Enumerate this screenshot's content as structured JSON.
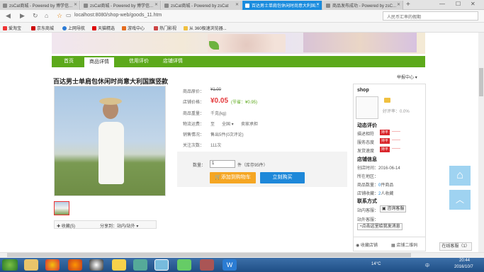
{
  "browser": {
    "tabs": [
      {
        "label": "zsCat商城 - Powered by 博学信...",
        "active": false
      },
      {
        "label": "zsCat商城 - Powered by 博学信...",
        "active": false
      },
      {
        "label": "zsCat商城 - Powered by zsCat",
        "active": false
      },
      {
        "label": "百达男士单肩包休闲时尚意大利国...",
        "active": true
      },
      {
        "label": "商品发布成功 - Powered by zsC...",
        "active": false
      }
    ],
    "new_tab": "+",
    "url": "localhost:8080/shop-web/goods_11.htm",
    "search_placeholder": "人民币汇率的假期",
    "bookmarks": [
      "爱淘宝",
      "京东商城",
      "上网导航",
      "天猫精选",
      "游戏中心",
      "热门影视",
      "从 360极速浏览器..."
    ]
  },
  "nav": {
    "items": [
      "首页",
      "商品详情",
      "信用评价",
      "店铺详情"
    ]
  },
  "product": {
    "title": "百达男士单肩包休闲时尚意大利国旗竖款",
    "report": "举报中心",
    "fields": {
      "orig_price_label": "商品原价：",
      "orig_price": "¥1.00",
      "shop_price_label": "店铺价格：",
      "shop_price": "¥0.05",
      "saving": "(节省：¥0.95)",
      "weight_label": "商品重量：",
      "weight": "千克(kg)",
      "shipping_label": "物流运费：",
      "shipping_to": "至",
      "shipping_region": "全国",
      "shipping_pay": "卖家承担",
      "sales_label": "销售情况：",
      "sales": "售出5件(0次评论)",
      "attention_label": "关注次数：",
      "attention": "111次"
    },
    "qty_label": "数量：",
    "qty_value": "1",
    "stock": "件（库存95件）",
    "add_to_cart": "添加到购物车",
    "buy_now": "立刻购买",
    "favorite": "收藏(5)",
    "share": "分享到：站内/站外"
  },
  "shop": {
    "name": "shop",
    "rating": "好评率：0.0%",
    "dynamic_title": "动态评价",
    "scores": [
      {
        "label": "描述相符",
        "badge": "持平",
        "value": "------"
      },
      {
        "label": "服务态度",
        "badge": "持平",
        "value": "------"
      },
      {
        "label": "发货速度",
        "badge": "持平",
        "value": "------"
      }
    ],
    "info_title": "店铺信息",
    "created": "创店时间：2016-06-14",
    "region": "所在地区：",
    "goods_count_label": "商品数量：",
    "goods_count": "0",
    "goods_count_unit": "件商品",
    "favorites_label": "店铺收藏：",
    "favorites": "2",
    "favorites_unit": "人收藏",
    "contact_title": "联系方式",
    "station_service": "站内客服：",
    "consult_button": "咨询客服",
    "external_service": "站外客服：",
    "send_msg_button": "点击这里给我发消息",
    "fav_shop": "收藏店铺",
    "qr_code": "店铺二维码"
  },
  "floats": {
    "online_service": "在线客服（1）"
  },
  "taskbar": {
    "temp": "14°C",
    "lang": "中",
    "time": "20:44",
    "date": "2016/10/7"
  }
}
